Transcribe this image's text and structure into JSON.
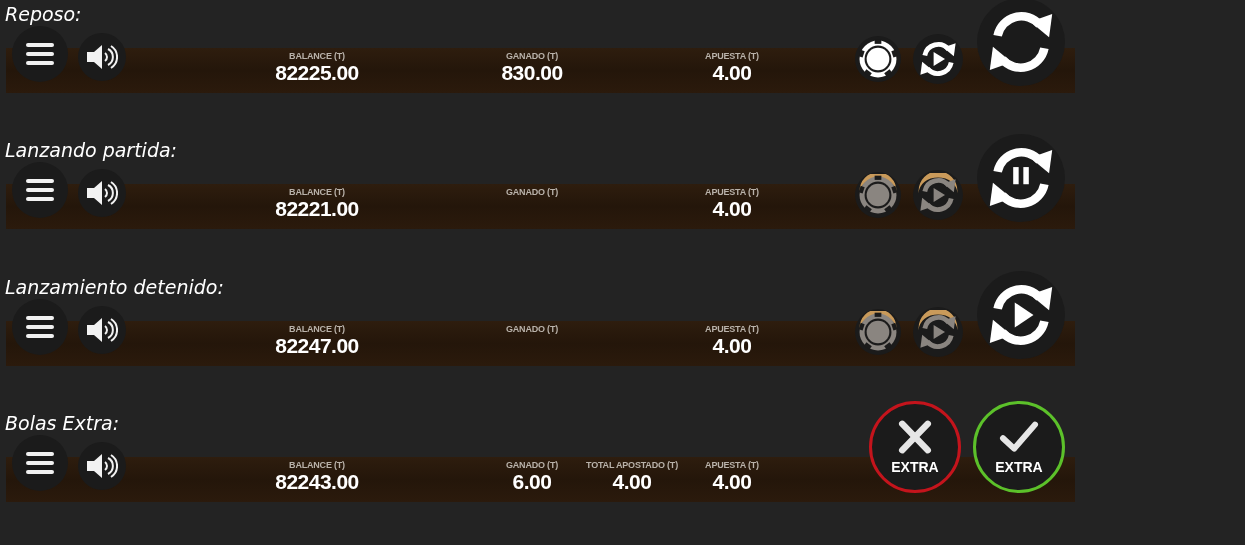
{
  "panels": [
    {
      "caption": "Reposo:",
      "stats": [
        {
          "label": "BALANCE (T)",
          "value": "82225.00"
        },
        {
          "label": "GANADO (T)",
          "value": "830.00"
        },
        {
          "label": "APUESTA (T)",
          "value": "4.00"
        }
      ],
      "controls": [
        {
          "kind": "chip",
          "disabled": false
        },
        {
          "kind": "autoplay",
          "disabled": false
        },
        {
          "kind": "spin"
        }
      ]
    },
    {
      "caption": "Lanzando partida:",
      "stats": [
        {
          "label": "BALANCE (T)",
          "value": "82221.00"
        },
        {
          "label": "GANADO (T)"
        },
        {
          "label": "APUESTA (T)",
          "value": "4.00"
        }
      ],
      "controls": [
        {
          "kind": "chip",
          "disabled": true
        },
        {
          "kind": "autoplay",
          "disabled": true
        },
        {
          "kind": "pause"
        }
      ]
    },
    {
      "caption": "Lanzamiento detenido:",
      "stats": [
        {
          "label": "BALANCE (T)",
          "value": "82247.00"
        },
        {
          "label": "GANADO (T)"
        },
        {
          "label": "APUESTA (T)",
          "value": "4.00"
        }
      ],
      "controls": [
        {
          "kind": "chip",
          "disabled": true
        },
        {
          "kind": "autoplay",
          "disabled": true
        },
        {
          "kind": "play"
        }
      ]
    },
    {
      "caption": "Bolas Extra:",
      "stats": [
        {
          "label": "BALANCE (T)",
          "value": "82243.00"
        },
        {
          "label": "GANADO (T)",
          "value": "6.00"
        },
        {
          "label": "TOTAL APOSTADO (T)",
          "value": "4.00"
        },
        {
          "label": "APUESTA (T)",
          "value": "4.00"
        }
      ],
      "controls": [
        {
          "kind": "cancel",
          "label": "EXTRA"
        },
        {
          "kind": "confirm",
          "label": "EXTRA"
        }
      ]
    }
  ]
}
